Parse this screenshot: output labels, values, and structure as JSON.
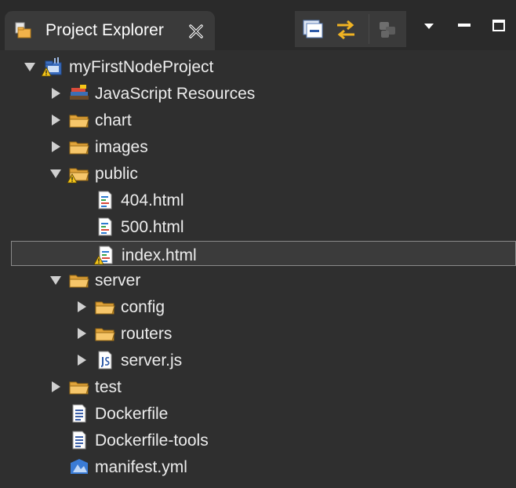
{
  "tab": {
    "title": "Project Explorer",
    "icon": "project-explorer-icon",
    "close_icon": "close-icon"
  },
  "toolbar": {
    "collapse_all": "collapse-all-icon",
    "link_with_editor": "link-with-editor-icon",
    "filter": "filter-icon",
    "view_menu": "chevron-down-icon",
    "minimize": "minimize-icon",
    "maximize": "maximize-icon"
  },
  "tree": [
    {
      "label": "myFirstNodeProject",
      "icon": "project-icon",
      "expanded": true,
      "depth": 0,
      "warning": true
    },
    {
      "label": "JavaScript Resources",
      "icon": "library-icon",
      "expanded": false,
      "depth": 1
    },
    {
      "label": "chart",
      "icon": "folder-icon",
      "expanded": false,
      "depth": 1
    },
    {
      "label": "images",
      "icon": "folder-icon",
      "expanded": false,
      "depth": 1
    },
    {
      "label": "public",
      "icon": "folder-icon",
      "expanded": true,
      "depth": 1,
      "warning": true
    },
    {
      "label": "404.html",
      "icon": "html-file-icon",
      "depth": 2
    },
    {
      "label": "500.html",
      "icon": "html-file-icon",
      "depth": 2
    },
    {
      "label": "index.html",
      "icon": "html-file-icon",
      "depth": 2,
      "warning": true,
      "selected": true
    },
    {
      "label": "server",
      "icon": "folder-icon",
      "expanded": true,
      "depth": 1
    },
    {
      "label": "config",
      "icon": "folder-icon",
      "expanded": false,
      "depth": 2
    },
    {
      "label": "routers",
      "icon": "folder-icon",
      "expanded": false,
      "depth": 2
    },
    {
      "label": "server.js",
      "icon": "js-file-icon",
      "expanded": false,
      "depth": 2
    },
    {
      "label": "test",
      "icon": "folder-icon",
      "expanded": false,
      "depth": 1
    },
    {
      "label": "Dockerfile",
      "icon": "text-file-icon",
      "depth": 1
    },
    {
      "label": "Dockerfile-tools",
      "icon": "text-file-icon",
      "depth": 1
    },
    {
      "label": "manifest.yml",
      "icon": "yml-file-icon",
      "depth": 1
    }
  ],
  "colors": {
    "background": "#2f2f2f",
    "folder": "#f2b34a",
    "warning": "#f5c518",
    "selection_border": "#8a8a8a"
  }
}
